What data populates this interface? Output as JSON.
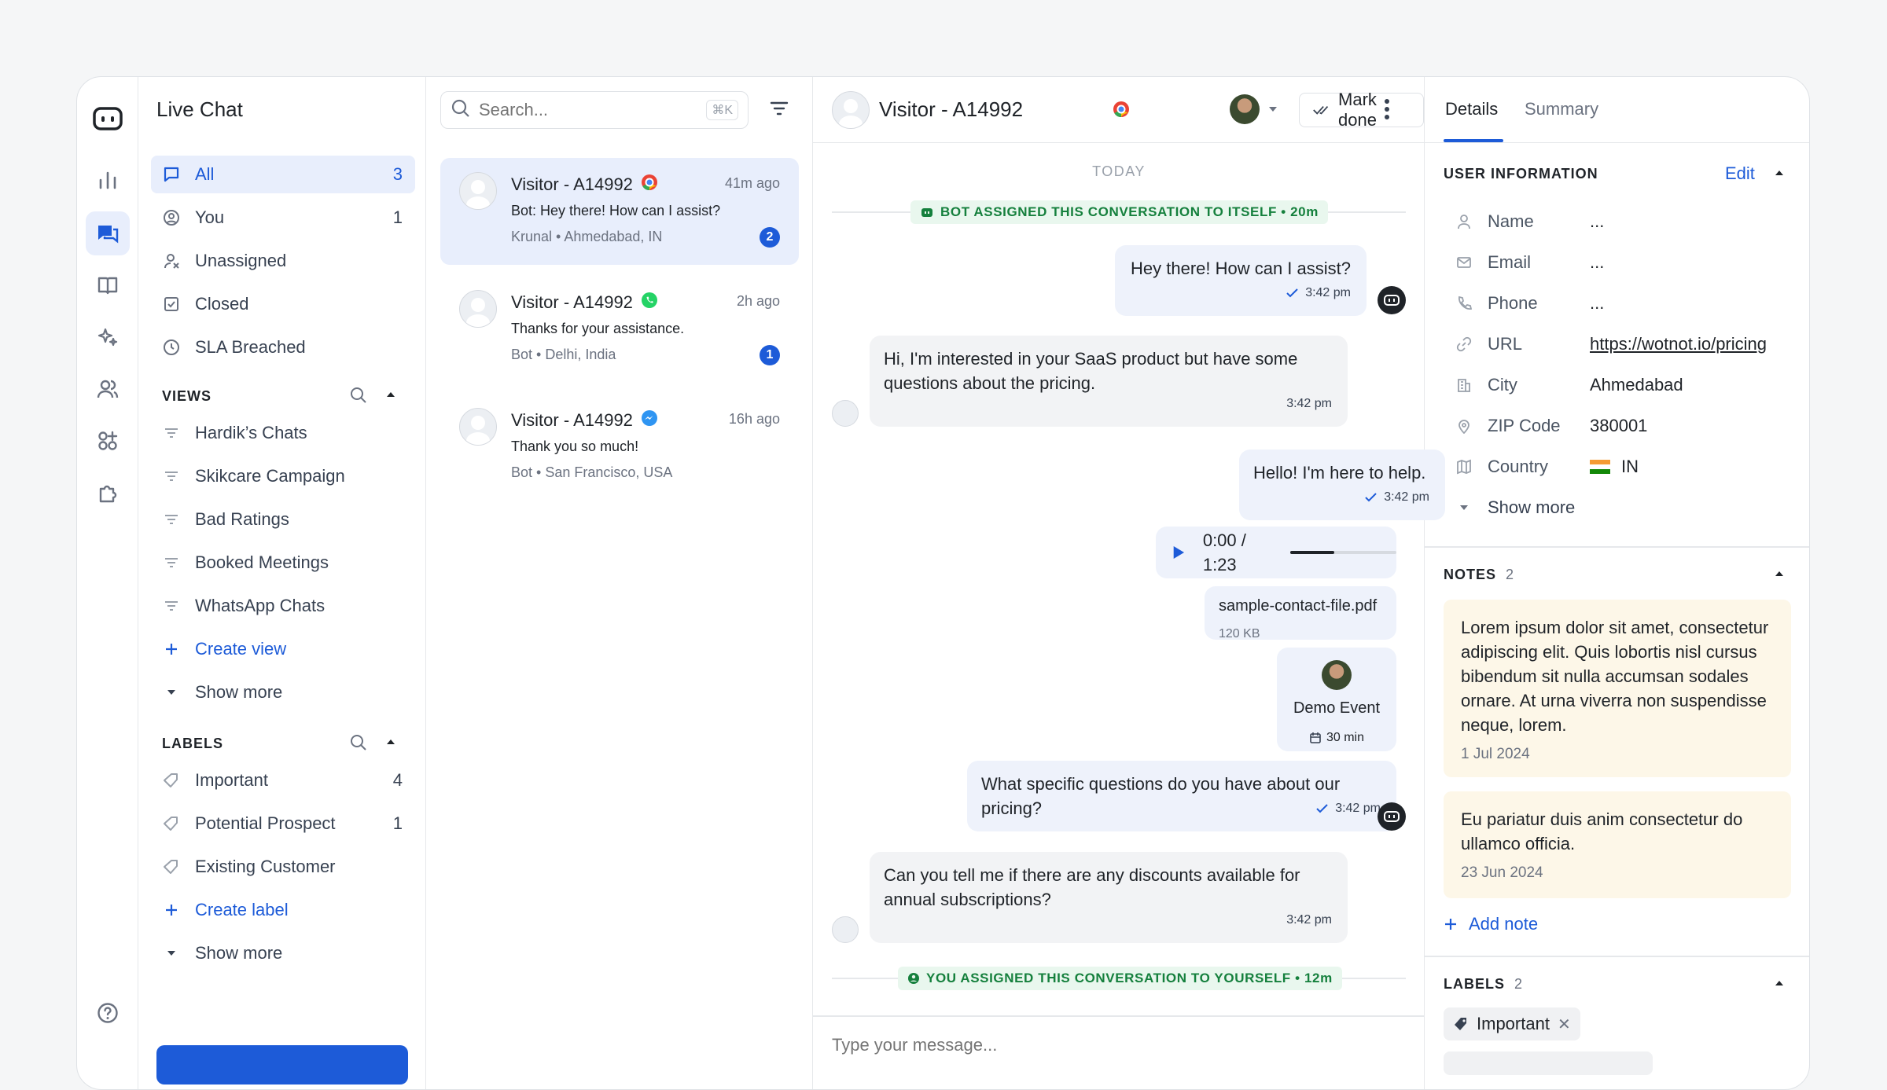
{
  "nav": {
    "title": "Live Chat",
    "items": [
      {
        "label": "All",
        "count": "3"
      },
      {
        "label": "You",
        "count": "1"
      },
      {
        "label": "Unassigned",
        "count": ""
      },
      {
        "label": "Closed",
        "count": ""
      },
      {
        "label": "SLA Breached",
        "count": ""
      }
    ],
    "views_title": "VIEWS",
    "views": [
      "Hardik’s Chats",
      "Skikcare Campaign",
      "Bad Ratings",
      "Booked Meetings",
      "WhatsApp Chats"
    ],
    "create_view": "Create view",
    "show_more": "Show more",
    "labels_title": "LABELS",
    "labels": [
      {
        "label": "Important",
        "count": "4"
      },
      {
        "label": "Potential Prospect",
        "count": "1"
      },
      {
        "label": "Existing Customer",
        "count": ""
      }
    ],
    "create_label": "Create label",
    "show_more_labels": "Show more"
  },
  "search": {
    "placeholder": "Search...",
    "shortcut": "⌘K"
  },
  "conversations": [
    {
      "name": "Visitor - A14992",
      "channel": "chrome",
      "time": "41m ago",
      "preview": "Bot: Hey there! How can I assist?",
      "who": "Krunal",
      "location": "Ahmedabad, IN",
      "unread": "2"
    },
    {
      "name": "Visitor - A14992",
      "channel": "whatsapp",
      "time": "2h ago",
      "preview": "Thanks for your assistance.",
      "who": "Bot",
      "location": "Delhi, India",
      "unread": "1"
    },
    {
      "name": "Visitor - A14992",
      "channel": "messenger",
      "time": "16h ago",
      "preview": "Thank you so much!",
      "who": "Bot",
      "location": "San Francisco, USA",
      "unread": ""
    }
  ],
  "chat": {
    "title": "Visitor - A14992",
    "mark_done": "Mark done",
    "day": "TODAY",
    "sys1": "BOT ASSIGNED THIS CONVERSATION TO ITSELF • 20m",
    "m1": "Hey there! How can I assist?",
    "m1_time": "3:42 pm",
    "m2": "Hi, I'm interested in your SaaS product but have some questions about the pricing.",
    "m2_time": "3:42 pm",
    "m3": "Hello! I'm here to help.",
    "m3_time": "3:42 pm",
    "audio": "0:00 / 1:23",
    "audio_progress": 0.42,
    "file_name": "sample-contact-file.pdf",
    "file_size": "120 KB",
    "event_name": "Demo Event",
    "event_duration": "30 min",
    "m4": "What specific questions do you have about our pricing?",
    "m4_time": "3:42 pm",
    "m5": "Can you tell me if there are any discounts available for annual subscriptions?",
    "m5_time": "3:42 pm",
    "sys2": "YOU ASSIGNED THIS CONVERSATION TO YOURSELF • 12m",
    "input_placeholder": "Type your message..."
  },
  "details": {
    "tab_details": "Details",
    "tab_summary": "Summary",
    "user_info_title": "USER INFORMATION",
    "edit": "Edit",
    "fields": [
      {
        "label": "Name",
        "value": "..."
      },
      {
        "label": "Email",
        "value": "..."
      },
      {
        "label": "Phone",
        "value": "..."
      },
      {
        "label": "URL",
        "value": "https://wotnot.io/pricing"
      },
      {
        "label": "City",
        "value": "Ahmedabad"
      },
      {
        "label": "ZIP Code",
        "value": "380001"
      },
      {
        "label": "Country",
        "value": "IN"
      }
    ],
    "show_more": "Show more",
    "notes_title": "NOTES",
    "notes_count": "2",
    "notes": [
      {
        "text": "Lorem ipsum dolor sit amet, consectetur adipiscing elit. Quis lobortis nisl cursus bibendum sit nulla accumsan sodales ornare. At urna viverra non suspendisse neque, lorem.",
        "date": "1 Jul 2024"
      },
      {
        "text": "Eu pariatur duis anim consectetur do ullamco officia.",
        "date": "23 Jun 2024"
      }
    ],
    "add_note": "Add note",
    "labels_title": "LABELS",
    "labels_count": "2",
    "labels": [
      "Important"
    ]
  },
  "colors": {
    "accent": "#1d5bd8",
    "note_bg": "#fdf7e8",
    "system_green": "#15803d"
  }
}
